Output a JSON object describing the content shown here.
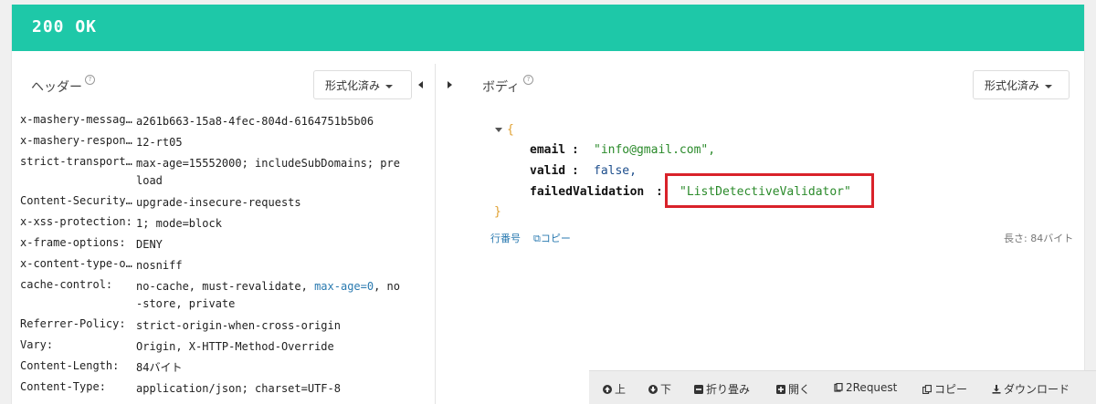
{
  "status": "200 OK",
  "headers_panel": {
    "title": "ヘッダー",
    "format_button": "形式化済み",
    "rows": [
      {
        "key": "x-mashery-messag…",
        "value": "a261b663-15a8-4fec-804d-6164751b5b06"
      },
      {
        "key": "x-mashery-respon…",
        "value": "12-rt05"
      },
      {
        "key": "strict-transport…",
        "value": "max-age=15552000; includeSubDomains; preload"
      },
      {
        "key": "Content-Security…",
        "value": "upgrade-insecure-requests"
      },
      {
        "key": "x-xss-protection:",
        "value": "1; mode=block"
      },
      {
        "key": "x-frame-options:",
        "value": "DENY"
      },
      {
        "key": "x-content-type-o…",
        "value": "nosniff"
      },
      {
        "key": "cache-control:",
        "value_pre": "no-cache, must-revalidate, ",
        "value_link": "max-age=0",
        "value_post": ", no-store, private"
      },
      {
        "key": "Referrer-Policy:",
        "value": "strict-origin-when-cross-origin"
      },
      {
        "key": "Vary:",
        "value": "Origin, X-HTTP-Method-Override"
      },
      {
        "key": "Content-Length:",
        "value": "84バイト"
      },
      {
        "key": "Content-Type:",
        "value": "application/json; charset=UTF-8"
      }
    ]
  },
  "body_panel": {
    "title": "ボディ",
    "format_button": "形式化済み",
    "json": {
      "open": "{",
      "close": "}",
      "email_key": "email",
      "email_val": "\"info@gmail.com\",",
      "valid_key": "valid",
      "valid_val": "false,",
      "failed_key": "failedValidation",
      "failed_val": "\"ListDetectiveValidator\""
    },
    "line_numbers_link": "行番号",
    "copy_link": "コピー",
    "length_label": "長さ: 84バイト"
  },
  "toolbar": {
    "up": "上",
    "down": "下",
    "fold": "折り畳み",
    "open": "開く",
    "request": "2Request",
    "copy": "コピー",
    "download": "ダウンロード"
  },
  "colors": {
    "status_bar": "#1ec8a8",
    "highlight_border": "#d9222a",
    "json_string": "#2a8a2a",
    "json_brace": "#e0a030",
    "link": "#2a7ab0"
  }
}
